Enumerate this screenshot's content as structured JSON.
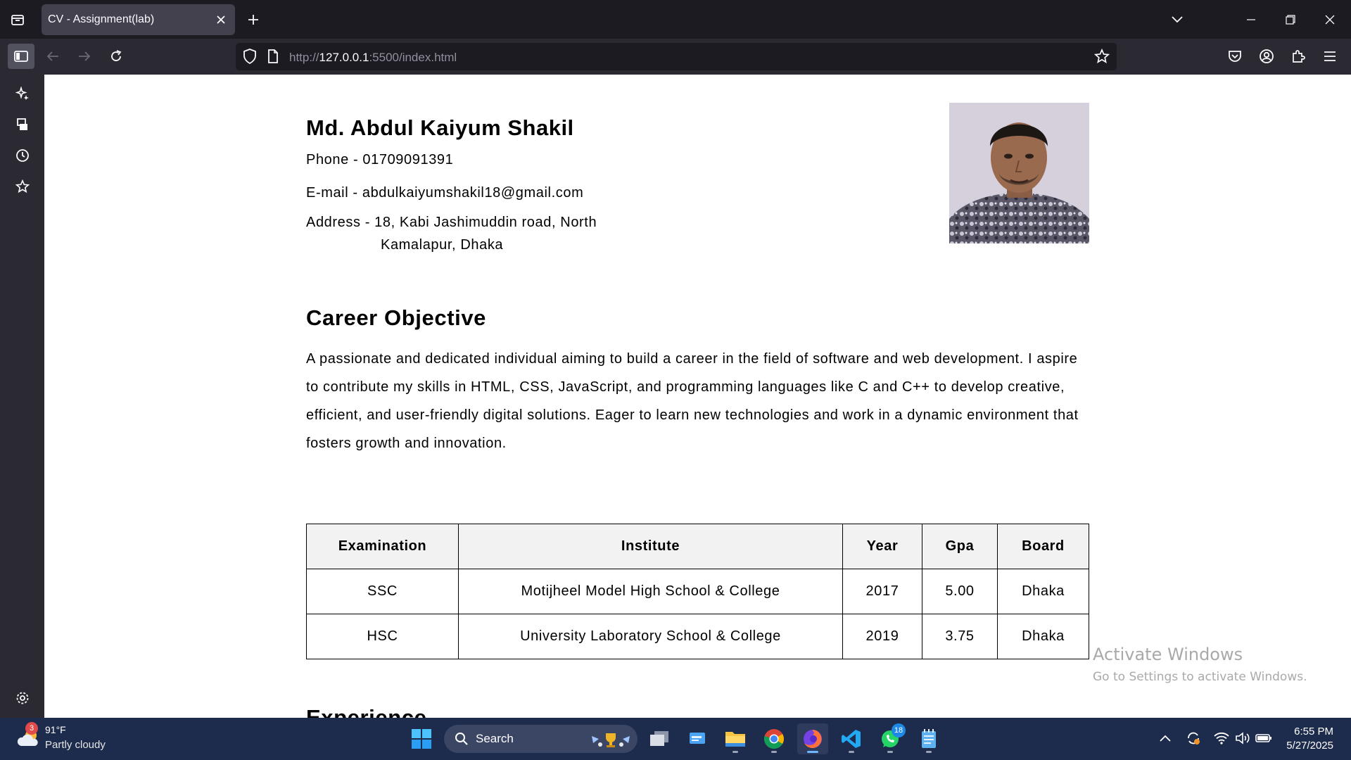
{
  "browser": {
    "tab_title": "CV - Assignment(lab)",
    "url_prefix": "http://",
    "url_host": "127.0.0.1",
    "url_rest": ":5500/index.html"
  },
  "cv": {
    "name": "Md. Abdul Kaiyum Shakil",
    "phone": "Phone - 01709091391",
    "email": "E-mail - abdulkaiyumshakil18@gmail.com",
    "address_line1": "Address - 18, Kabi Jashimuddin road, North",
    "address_line2": "Kamalapur, Dhaka",
    "career_title": "Career Objective",
    "career_text": "A passionate and dedicated individual aiming to build a career in the field of software and web development. I aspire to contribute my skills in HTML, CSS, JavaScript, and programming languages like C and C++ to develop creative, efficient, and user-friendly digital solutions. Eager to learn new technologies and work in a dynamic environment that fosters growth and innovation.",
    "education": {
      "headers": [
        "Examination",
        "Institute",
        "Year",
        "Gpa",
        "Board"
      ],
      "rows": [
        [
          "SSC",
          "Motijheel Model High School & College",
          "2017",
          "5.00",
          "Dhaka"
        ],
        [
          "HSC",
          "University Laboratory School & College",
          "2019",
          "3.75",
          "Dhaka"
        ]
      ]
    },
    "experience_title": "Experience"
  },
  "watermark": {
    "line1": "Activate Windows",
    "line2": "Go to Settings to activate Windows."
  },
  "taskbar": {
    "weather_temp": "91°F",
    "weather_desc": "Partly cloudy",
    "weather_badge": "3",
    "search_label": "Search",
    "whatsapp_badge": "18",
    "time": "6:55 PM",
    "date": "5/27/2025"
  },
  "icons": {
    "tab_list": "tab-list-icon",
    "close": "close-icon",
    "new_tab": "plus-icon",
    "sidebar_toggle": "sidebar-icon",
    "back": "back-arrow-icon",
    "forward": "forward-arrow-icon",
    "reload": "reload-icon",
    "shield": "shield-icon",
    "page": "page-icon",
    "bookmark": "star-icon",
    "pocket": "pocket-icon",
    "account": "account-icon",
    "extensions": "puzzle-icon",
    "menu": "hamburger-icon"
  },
  "colors": {
    "chrome_dark": "#1c1b22",
    "toolbar": "#2b2a33",
    "active_tab": "#42414d",
    "taskbar": "#1d2b4c",
    "table_header": "#f2f2f2"
  }
}
